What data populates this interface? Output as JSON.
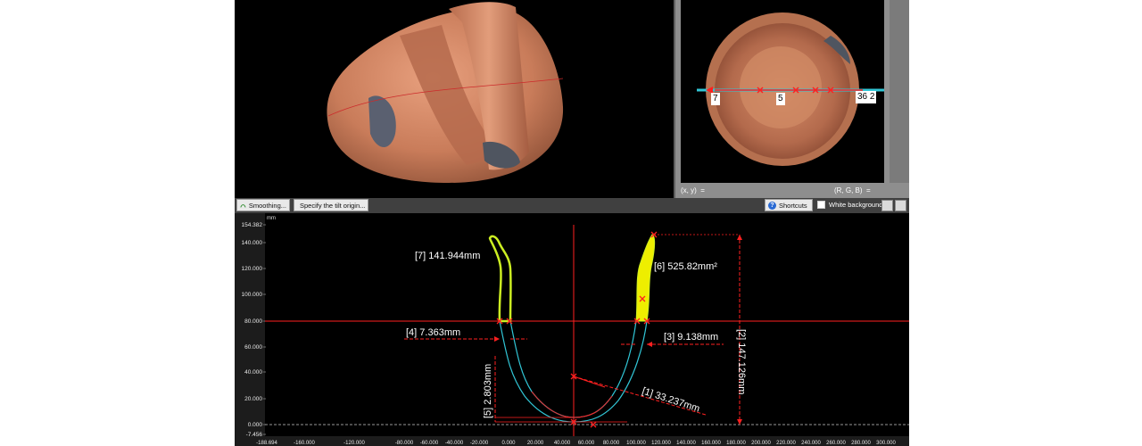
{
  "top_view": {
    "xy_readout": "(x, y)  =",
    "rgb_readout": "(R, G, B)  =",
    "labels": [
      "7",
      "5",
      "36 2"
    ]
  },
  "toolbar": {
    "smoothing_label": "Smoothing...",
    "tilt_label": "Specify the tilt origin...",
    "shortcuts_label": "Shortcuts",
    "white_background_label": "White background"
  },
  "plot": {
    "units": "mm",
    "y_ticks": [
      "154.382",
      "140.000",
      "120.000",
      "100.000",
      "80.000",
      "60.000",
      "40.000",
      "20.000",
      "0.000",
      "-7.456"
    ],
    "x_ticks": [
      "-188.694",
      "-160.000",
      "-120.000",
      "-80.000",
      "-60.000",
      "-40.000",
      "-20.000",
      "0.000",
      "20.000",
      "40.000",
      "60.000",
      "80.000",
      "100.000",
      "120.000",
      "140.000",
      "160.000",
      "180.000",
      "200.000",
      "220.000",
      "240.000",
      "260.000",
      "280.000",
      "300.000"
    ],
    "annotations": {
      "a7": "[7] 141.944mm",
      "a6": "[6] 525.82mm²",
      "a4": "[4] 7.363mm",
      "a3": "[3] 9.138mm",
      "a2": "[2] 147.126mm",
      "a1": "[1] 33.237mm",
      "a5": "[5] 2.803mm"
    },
    "colors": {
      "measure": "#ff2020",
      "profile": "#31c5d5",
      "highlight": "#ccee22",
      "fill": "#eeee00"
    }
  }
}
